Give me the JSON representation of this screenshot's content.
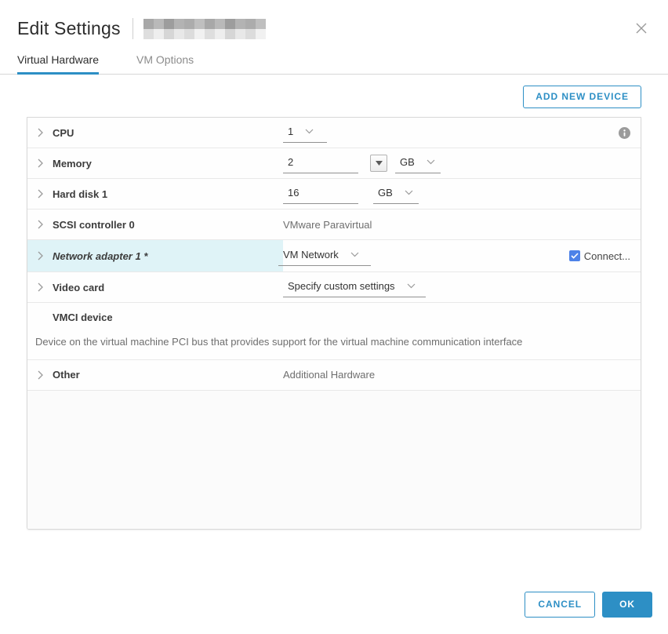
{
  "dialog": {
    "title": "Edit Settings"
  },
  "tabs": {
    "virtual_hardware": "Virtual Hardware",
    "vm_options": "VM Options"
  },
  "toolbar": {
    "add_new_device": "ADD NEW DEVICE"
  },
  "rows": {
    "cpu": {
      "label": "CPU",
      "value": "1"
    },
    "memory": {
      "label": "Memory",
      "value": "2",
      "unit": "GB"
    },
    "hard_disk": {
      "label": "Hard disk 1",
      "value": "16",
      "unit": "GB"
    },
    "scsi": {
      "label": "SCSI controller 0",
      "value": "VMware Paravirtual"
    },
    "network": {
      "label": "Network adapter 1 *",
      "value": "VM Network",
      "connect_label": "Connect...",
      "connected_checked": true
    },
    "video": {
      "label": "Video card",
      "value": "Specify custom settings"
    },
    "vmci": {
      "label": "VMCI device",
      "description": "Device on the virtual machine PCI bus that provides support for the virtual machine communication interface"
    },
    "other": {
      "label": "Other",
      "value": "Additional Hardware"
    }
  },
  "footer": {
    "cancel": "CANCEL",
    "ok": "OK"
  },
  "colors": {
    "primary_blue": "#2D8FC5",
    "checkbox_blue": "#4D82E8",
    "row_highlight": "#DFF3F7",
    "muted_text": "#6E6E6E"
  }
}
